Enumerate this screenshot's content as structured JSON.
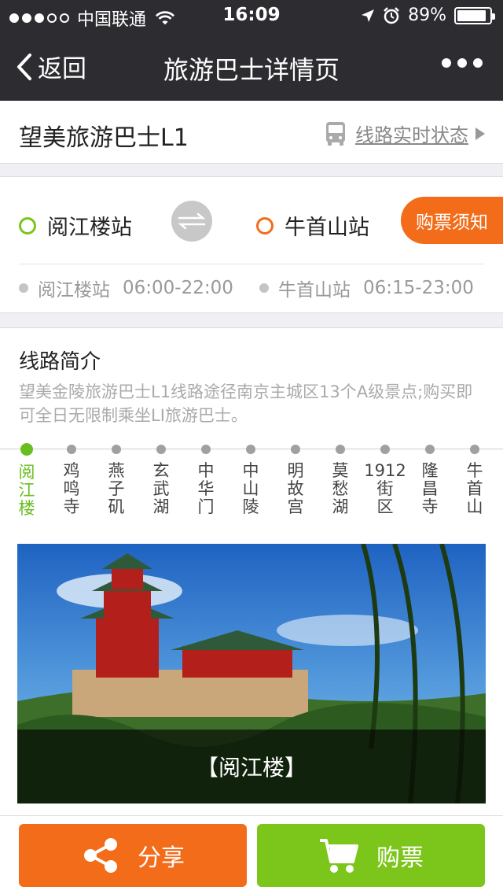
{
  "status_bar": {
    "carrier": "中国联通",
    "time": "16:09",
    "battery": "89%",
    "battery_level": 0.89,
    "signal_bars": 3,
    "signal_total": 5
  },
  "nav": {
    "back_label": "返回",
    "title": "旅游巴士详情页"
  },
  "route": {
    "name": "望美旅游巴士L1",
    "live_status_label": "线路实时状态"
  },
  "stations": {
    "from": "阅江楼站",
    "to": "牛首山站",
    "from_color": "#7cc51a",
    "to_color": "#f36c1a",
    "ticket_notice": "购票须知",
    "schedule": [
      {
        "station": "阅江楼站",
        "hours": "06:00-22:00"
      },
      {
        "station": "牛首山站",
        "hours": "06:15-23:00"
      }
    ]
  },
  "intro": {
    "title": "线路简介",
    "description": "望美金陵旅游巴士L1线路途径南京主城区13个A级景点;购买即可全日无限制乘坐LI旅游巴士。",
    "stops": [
      "阅江楼",
      "鸡鸣寺",
      "燕子矶",
      "玄武湖",
      "中华门",
      "中山陵",
      "明故宫",
      "莫愁湖",
      "1912街区",
      "隆昌寺",
      "牛首山"
    ],
    "active_stop": 0,
    "photo_caption": "【阅江楼】"
  },
  "actions": {
    "share_label": "分享",
    "buy_label": "购票",
    "share_color": "#f36c1a",
    "buy_color": "#7cc51a"
  }
}
